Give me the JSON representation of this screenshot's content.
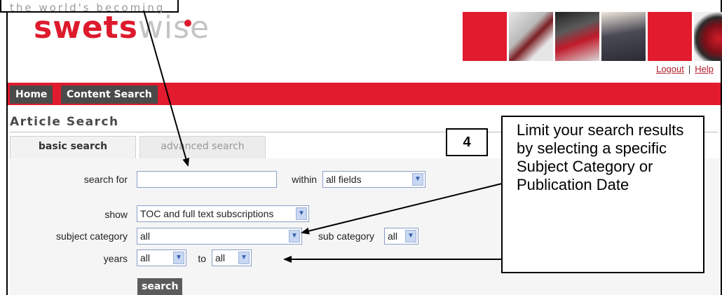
{
  "header": {
    "tagline": "the world's becoming",
    "logo_part1": "swets",
    "logo_part2": "wise"
  },
  "util_links": {
    "logout": "Logout",
    "separator": "|",
    "help": "Help"
  },
  "nav": {
    "home": "Home",
    "content_search": "Content Search"
  },
  "page_title": "Article Search",
  "tabs": {
    "basic": "basic search",
    "advanced": "advanced search"
  },
  "form": {
    "search_for_label": "search for",
    "search_for_value": "",
    "within_label": "within",
    "within_value": "all fields",
    "show_label": "show",
    "show_value": "TOC and full text subscriptions",
    "subject_category_label": "subject category",
    "subject_category_value": "all",
    "sub_category_label": "sub category",
    "sub_category_value": "all",
    "years_label": "years",
    "years_from_value": "all",
    "to_label": "to",
    "years_to_value": "all",
    "search_button": "search"
  },
  "annotation": {
    "step_number": "4",
    "text": "Limit your search results by selecting a specific Subject Category or Publication Date"
  },
  "colors": {
    "brand_red": "#e21b2f",
    "nav_tab": "#4a4a4a",
    "link": "#b01e2b"
  }
}
